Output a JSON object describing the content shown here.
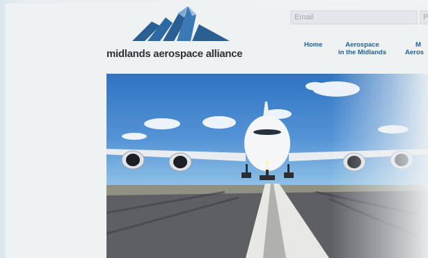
{
  "brand": {
    "name": "midlands aerospace alliance",
    "logo_icon": "mountain-peaks-icon",
    "accent": "#2a5f93"
  },
  "header": {
    "email_placeholder": "Email",
    "password_placeholder": "P"
  },
  "nav": {
    "items": [
      {
        "line1": "Home",
        "line2": ""
      },
      {
        "line1": "Aerospace",
        "line2": "in the Midlands"
      },
      {
        "line1": "M",
        "line2": "Aeros"
      }
    ]
  },
  "hero": {
    "image": "airliner-on-runway"
  }
}
